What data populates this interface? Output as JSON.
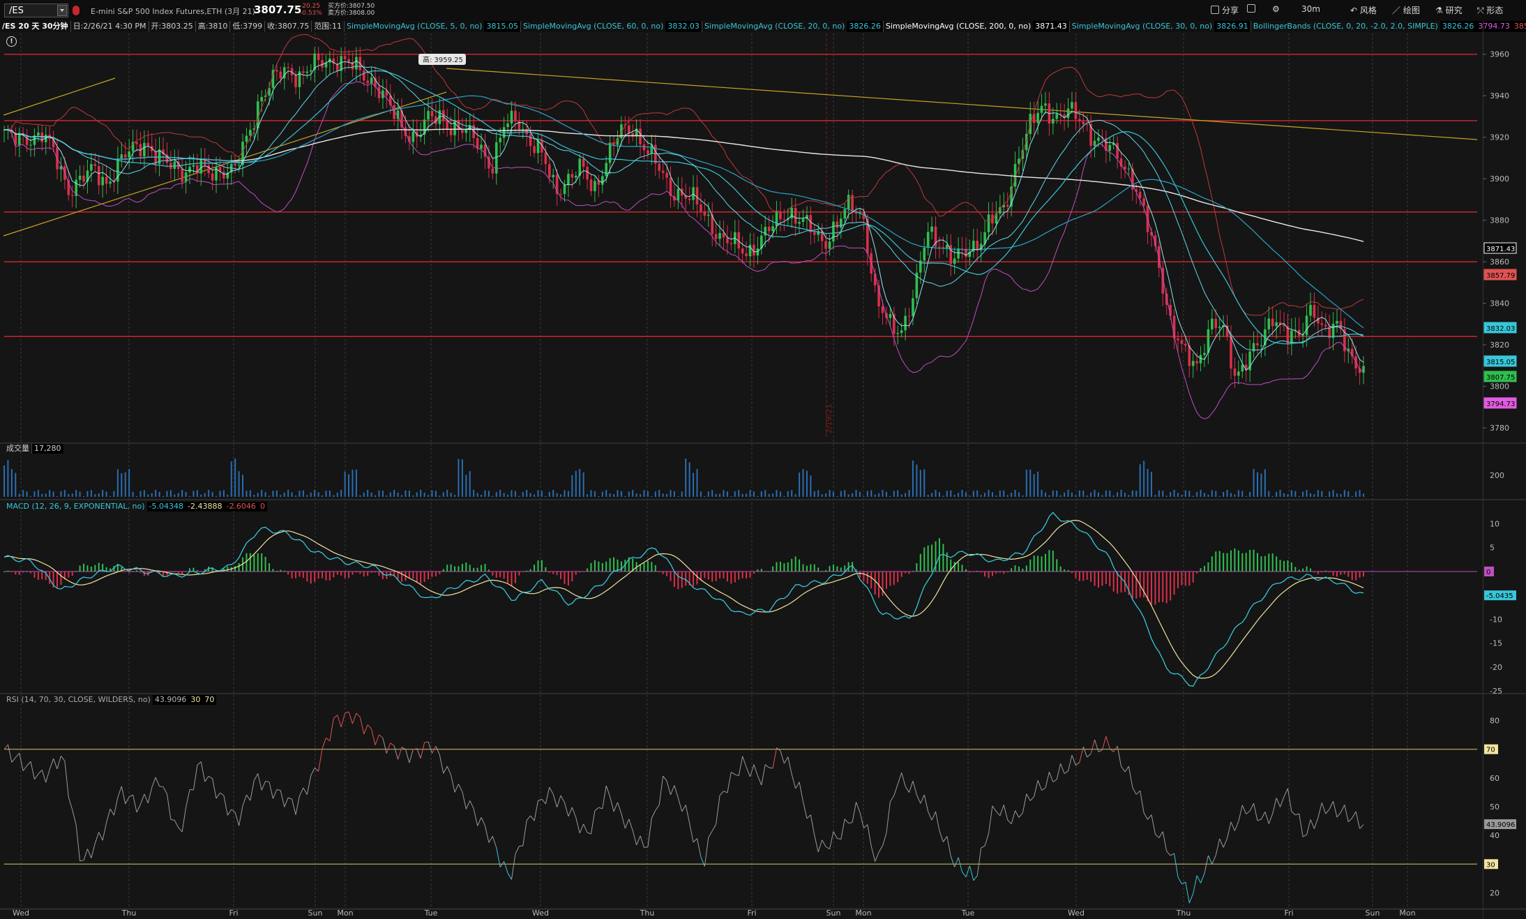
{
  "header": {
    "symbol": "/ES",
    "description": "E-mini S&P 500 Index Futures,ETH (3月 21)",
    "last_price": "3807.75",
    "change": "-20.25",
    "change_pct": "-0.53%",
    "bid": "买方价:3807.50",
    "ask": "卖方价:3808.00",
    "tools": [
      "分享",
      "30m",
      "风格",
      "绘图",
      "研究",
      "形态"
    ],
    "colors": {
      "down": "#e05252",
      "accent": "#2aa4c6"
    }
  },
  "infobar": {
    "title": "/ES 20 天 30分钟",
    "ohlc": [
      "日:2/26/21 4:30 PM",
      "开:3803.25",
      "高:3810",
      "低:3799",
      "收:3807.75",
      "范围:11"
    ],
    "studies": [
      {
        "name": "SimpleMovingAvg (CLOSE, 5, 0, no)",
        "value": "3815.05",
        "color": "#38c6d8"
      },
      {
        "name": "SimpleMovingAvg (CLOSE, 60, 0, no)",
        "value": "3832.03",
        "color": "#38c6d8"
      },
      {
        "name": "SimpleMovingAvg (CLOSE, 20, 0, no)",
        "value": "3826.26",
        "color": "#38c6d8"
      },
      {
        "name": "SimpleMovingAvg (CLOSE, 200, 0, no)",
        "value": "3871.43",
        "color": "#ffffff"
      },
      {
        "name": "SimpleMovingAvg (CLOSE, 30, 0, no)",
        "value": "3826.91",
        "color": "#38c6d8"
      },
      {
        "name": "BollingerBands (CLOSE, 0, 20, -2.0, 2.0, SIMPLE)",
        "value": "3826.26",
        "color": "#38c6d8"
      }
    ],
    "bb_extra": [
      {
        "value": "3794.73",
        "color": "#e05ce0"
      },
      {
        "value": "3857.79",
        "color": "#e05252"
      }
    ]
  },
  "volume_label": {
    "name": "成交量",
    "value": "17,280"
  },
  "macd_label": {
    "name": "MACD (12, 26, 9, EXPONENTIAL, no)",
    "values": [
      "-5.04348",
      "-2.43888",
      "-2.6046",
      "0"
    ]
  },
  "rsi_label": {
    "name": "RSI (14, 70, 30, CLOSE, WILDERS, no)",
    "values": [
      "43.9096",
      "30",
      "70"
    ]
  },
  "annotation": {
    "high_label": "高: 3959.25",
    "date_marker": "2/19/21"
  },
  "chart_data": [
    {
      "type": "candlestick",
      "title": "/ES 20 天 30分钟",
      "ylim": [
        3775,
        3970
      ],
      "y_ticks": [
        3780,
        3800,
        3820,
        3840,
        3860,
        3880,
        3900,
        3920,
        3940,
        3960
      ],
      "x_day_labels": [
        "Wed",
        "Thu",
        "Fri",
        "Sun",
        "Mon",
        "Tue",
        "Wed",
        "Thu",
        "Fri",
        "Sun",
        "Mon",
        "Tue",
        "Wed",
        "Thu",
        "Fri",
        "Sun",
        "Mon"
      ],
      "close_path": [
        [
          3922,
          3918,
          3920,
          3922,
          3910,
          3895,
          3900,
          3904,
          3898,
          3908,
          3914,
          3918,
          3910,
          3906,
          3904,
          3906,
          3902,
          3905,
          3904,
          3920,
          3940,
          3948,
          3952,
          3950,
          3954,
          3956,
          3958,
          3955,
          3950
        ],
        [
          3946,
          3935,
          3925,
          3920,
          3928,
          3930,
          3925,
          3922,
          3918,
          3905,
          3925,
          3930,
          3918,
          3910,
          3895,
          3900,
          3905,
          3895,
          3910,
          3922,
          3925,
          3915,
          3905,
          3895,
          3892,
          3888,
          3880,
          3870,
          3868,
          3865
        ],
        [
          3870,
          3878,
          3885,
          3880,
          3875,
          3870,
          3878,
          3888,
          3882,
          3840,
          3830,
          3828,
          3845,
          3875,
          3870,
          3860,
          3865,
          3870,
          3880,
          3885,
          3910,
          3925,
          3935,
          3930,
          3932,
          3928,
          3920,
          3915,
          3910,
          3900
        ],
        [
          3880,
          3860,
          3830,
          3815,
          3810,
          3830,
          3828,
          3805,
          3815,
          3820,
          3835,
          3826,
          3822,
          3840,
          3826,
          3828,
          3815,
          3808
        ]
      ],
      "overlays": {
        "sma_5": "3815.05",
        "sma_20": "3826.26",
        "sma_30": "3826.91",
        "sma_60": "3832.03",
        "sma_200": "3871.43",
        "bb_upper": "3857.79",
        "bb_lower": "3794.73"
      },
      "horizontal_levels": [
        3960,
        3928,
        3884,
        3860,
        3824
      ],
      "price_tags": [
        {
          "value": "3871.43",
          "color": "#ffffff"
        },
        {
          "value": "3857.79",
          "color": "#e05252"
        },
        {
          "value": "3832.03",
          "color": "#38c6d8"
        },
        {
          "value": "3815.05",
          "color": "#38c6d8"
        },
        {
          "value": "3807.75",
          "color": "#2fbf4f"
        },
        {
          "value": "3794.73",
          "color": "#e05ce0"
        }
      ],
      "grid": true
    },
    {
      "type": "bar",
      "title": "成交量",
      "y_ticks": [
        200
      ],
      "last": "17,280"
    },
    {
      "type": "line",
      "title": "MACD (12, 26, 9, EXPONENTIAL, no)",
      "ylim": [
        -25,
        13
      ],
      "y_ticks": [
        10,
        5,
        -5,
        -10,
        -15,
        -20,
        -25
      ],
      "zero_tag": "0",
      "value_tag": "-5.0435",
      "macd_path": [
        3,
        2,
        -4,
        -1,
        1,
        0,
        -1,
        0,
        1,
        9,
        8,
        4,
        2,
        1,
        -2,
        -6,
        -3,
        -1,
        -6,
        -2,
        -7,
        -3,
        2,
        5,
        -2,
        -5,
        -9,
        -8,
        -3,
        -2,
        1,
        -9,
        -10,
        3,
        4,
        2,
        4,
        12,
        9,
        3,
        -7,
        -20,
        -24,
        -16,
        -8,
        -2,
        -1,
        -2,
        -5
      ],
      "grid": true
    },
    {
      "type": "line",
      "title": "RSI (14, 70, 30, CLOSE, WILDERS, no)",
      "ylim": [
        15,
        85
      ],
      "y_ticks": [
        80,
        60,
        50,
        40,
        20
      ],
      "levels": [
        70,
        30
      ],
      "value_tag": "43.9096",
      "rsi_path": [
        70,
        65,
        60,
        68,
        30,
        40,
        55,
        50,
        60,
        40,
        65,
        55,
        45,
        60,
        55,
        50,
        62,
        80,
        82,
        75,
        70,
        68,
        72,
        60,
        50,
        40,
        25,
        45,
        55,
        50,
        40,
        55,
        45,
        35,
        60,
        50,
        30,
        55,
        65,
        60,
        70,
        55,
        35,
        40,
        50,
        30,
        60,
        55,
        45,
        30,
        25,
        50,
        45,
        55,
        60,
        65,
        70,
        72,
        60,
        45,
        35,
        18,
        30,
        40,
        50,
        45,
        55,
        40,
        50,
        48,
        44
      ],
      "grid": true
    }
  ]
}
